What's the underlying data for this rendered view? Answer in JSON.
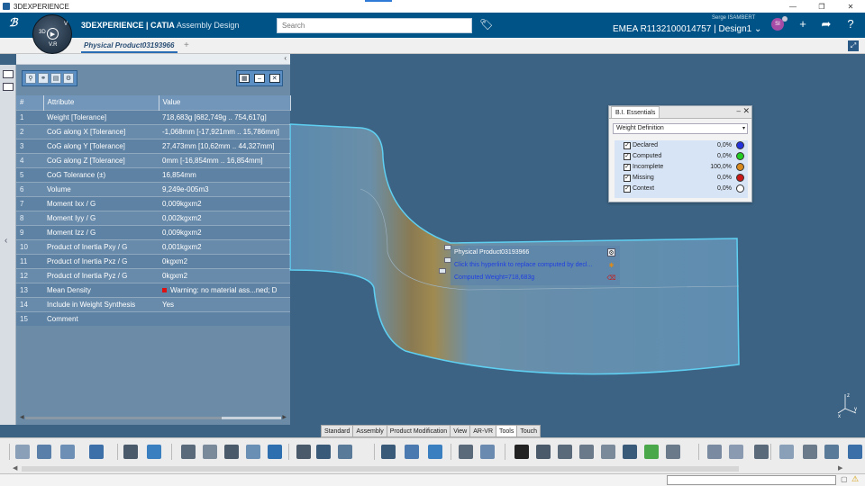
{
  "window": {
    "title": "3DEXPERIENCE"
  },
  "header": {
    "brand_bold": "3DEXPERIENCE | CATIA",
    "brand_app": "Assembly Design",
    "compass_left": "3D",
    "compass_right": "V",
    "version": "V.R",
    "search_placeholder": "Search",
    "user_name": "Serge ISAMBERT",
    "user_initials": "SI",
    "tenant": "EMEA R1132100014757 | Design1"
  },
  "tabs": [
    {
      "label": "Physical Product03193966"
    }
  ],
  "attributes": {
    "columns": [
      "#",
      "Attribute",
      "Value"
    ],
    "rows": [
      {
        "n": "1",
        "attr": "Weight [Tolerance]",
        "val": "718,683g [682,749g .. 754,617g]"
      },
      {
        "n": "2",
        "attr": "CoG along X [Tolerance]",
        "val": "-1,068mm [-17,921mm .. 15,786mm]"
      },
      {
        "n": "3",
        "attr": "CoG along Y [Tolerance]",
        "val": "27,473mm [10,62mm .. 44,327mm]"
      },
      {
        "n": "4",
        "attr": "CoG along Z [Tolerance]",
        "val": "0mm [-16,854mm .. 16,854mm]"
      },
      {
        "n": "5",
        "attr": "CoG Tolerance (±)",
        "val": "16,854mm"
      },
      {
        "n": "6",
        "attr": "Volume",
        "val": "9,249e-005m3"
      },
      {
        "n": "7",
        "attr": "Moment Ixx / G",
        "val": "0,009kgxm2"
      },
      {
        "n": "8",
        "attr": "Moment Iyy / G",
        "val": "0,002kgxm2"
      },
      {
        "n": "9",
        "attr": "Moment Izz / G",
        "val": "0,009kgxm2"
      },
      {
        "n": "10",
        "attr": "Product of Inertia Pxy / G",
        "val": "0,001kgxm2"
      },
      {
        "n": "11",
        "attr": "Product of Inertia Pxz / G",
        "val": "0kgxm2"
      },
      {
        "n": "12",
        "attr": "Product of Inertia Pyz / G",
        "val": "0kgxm2"
      },
      {
        "n": "13",
        "attr": "Mean Density",
        "val": "Warning: no material ass...ned; D"
      },
      {
        "n": "14",
        "attr": "Include in Weight Synthesis",
        "val": "Yes"
      },
      {
        "n": "15",
        "attr": "Comment",
        "val": ""
      }
    ]
  },
  "callout": {
    "title": "Physical Product03193966",
    "link": "Click this hyperlink to replace computed by decl...",
    "computed": "Computed Weight=718,683g"
  },
  "bi_essentials": {
    "tab": "B.I. Essentials",
    "selected": "Weight Definition",
    "rows": [
      {
        "label": "Declared",
        "value": "0,0%",
        "color": "#2233dd"
      },
      {
        "label": "Computed",
        "value": "0,0%",
        "color": "#22cc22"
      },
      {
        "label": "Incomplete",
        "value": "100,0%",
        "color": "#d98a1e"
      },
      {
        "label": "Missing",
        "value": "0,0%",
        "color": "#c81818"
      },
      {
        "label": "Context",
        "value": "0,0%",
        "color": "#ffffff"
      }
    ]
  },
  "command_tabs": [
    "Standard",
    "Assembly",
    "Product Modification",
    "View",
    "AR-VR",
    "Tools",
    "Touch"
  ],
  "active_command_tab": "Tools",
  "axis": {
    "x": "x",
    "y": "y",
    "z": "z"
  }
}
